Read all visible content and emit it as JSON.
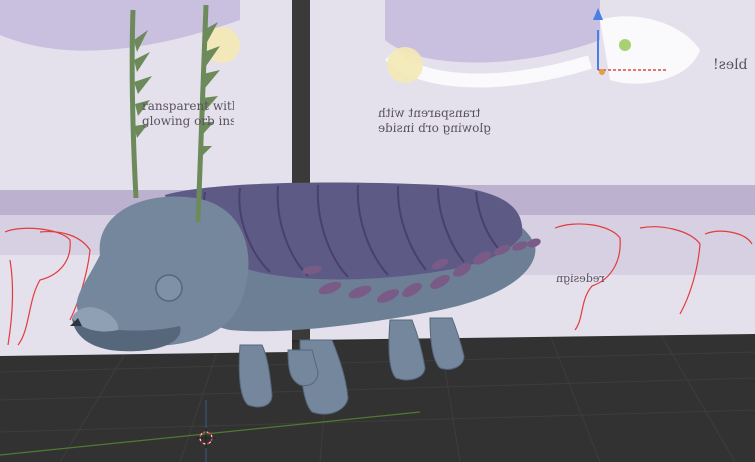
{
  "scene": {
    "description_tag": "3d-viewport",
    "colors": {
      "background": "#2b2b2b",
      "floor": "#323232",
      "grid_line": "#3d3d3d",
      "reference_sheet": "#e4e0ec",
      "reference_sheet_shadow": "#cfc8dc",
      "model_skin": "#74879c",
      "model_skin_dark": "#56677c",
      "model_shell": "#5e5a86",
      "model_shell_dark": "#46426a",
      "model_spikes": "#7a5a86",
      "antenna": "#6d8a5a",
      "axis_x": "#e04848",
      "axis_y": "#86c13a",
      "axis_z": "#4a7fe6",
      "construction_lines": "#e03030"
    }
  },
  "reference_images": {
    "left_text": "ransparent with\nglowing orb inside",
    "right_text": "transparent with\nglowing orb inside",
    "bottom_text": "redesign",
    "corner_text": "bles!"
  },
  "cursor": {
    "icon": "3d-cursor-icon"
  }
}
